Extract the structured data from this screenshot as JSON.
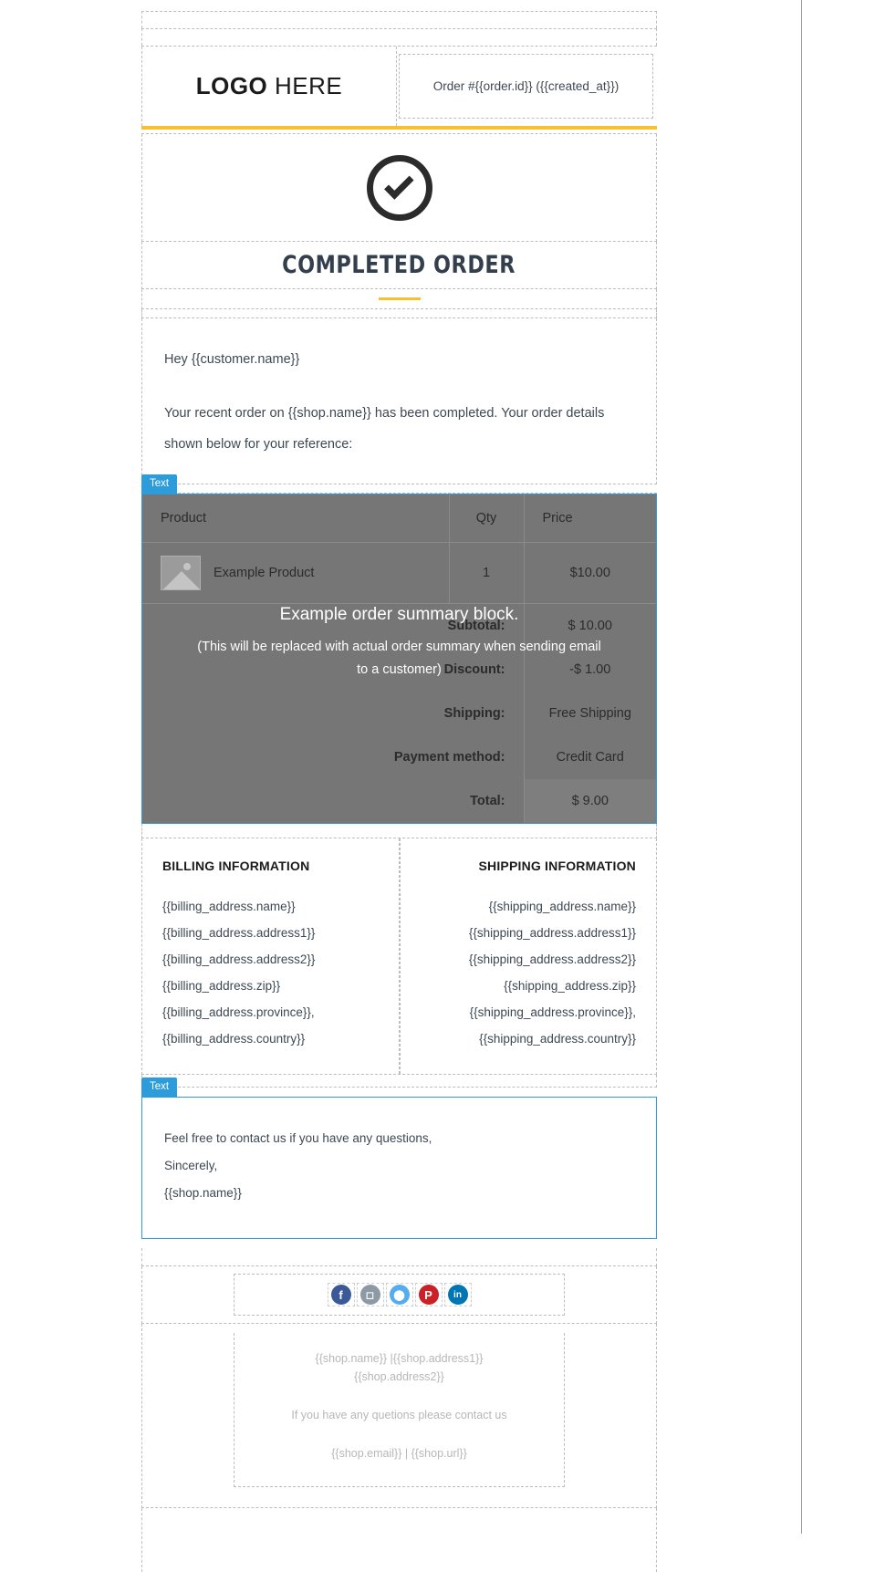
{
  "editor": {
    "selected_block_badge": "Text",
    "accent_color": "#f5c130",
    "selection_color": "#2d9cdb"
  },
  "header": {
    "logo_bold": "LOGO",
    "logo_light": "HERE",
    "order_id_line": "Order #{{order.id}} ({{created_at}})"
  },
  "hero": {
    "icon": "check-circle-icon",
    "title": "COMPLETED ORDER"
  },
  "intro": {
    "greeting": "Hey  {{customer.name}}",
    "body": "Your recent order on {{shop.name}}  has been completed. Your order details shown below for your reference:"
  },
  "order_table": {
    "columns": [
      "Product",
      "Qty",
      "Price"
    ],
    "rows": [
      {
        "product": "Example Product",
        "qty": "1",
        "price": "$10.00",
        "image": "image-placeholder-icon"
      }
    ],
    "summary": [
      {
        "label": "Subtotal:",
        "value": "$ 10.00"
      },
      {
        "label": "Discount:",
        "value": "-$ 1.00"
      },
      {
        "label": "Shipping:",
        "value": "Free Shipping"
      },
      {
        "label": "Payment method:",
        "value": "Credit Card"
      },
      {
        "label": "Total:",
        "value": "$ 9.00"
      }
    ],
    "overlay_title": "Example order summary block.",
    "overlay_note": "(This will be replaced with actual order summary when sending email to a customer)"
  },
  "billing": {
    "title": "BILLING INFORMATION",
    "lines": [
      "{{billing_address.name}}",
      "{{billing_address.address1}}",
      "{{billing_address.address2}}",
      "{{billing_address.zip}}",
      "{{billing_address.province}},",
      "{{billing_address.country}}"
    ]
  },
  "shipping": {
    "title": "SHIPPING INFORMATION",
    "lines": [
      "{{shipping_address.name}}",
      "{{shipping_address.address1}}",
      "{{shipping_address.address2}}",
      "{{shipping_address.zip}}",
      "{{shipping_address.province}},",
      "{{shipping_address.country}}"
    ]
  },
  "contact": {
    "line1": "Feel free to contact us if you have any questions,",
    "line2": "Sincerely,",
    "line3": "{{shop.name}}"
  },
  "footer": {
    "social": [
      {
        "name": "facebook-icon",
        "glyph": "f",
        "color": "#3b5998"
      },
      {
        "name": "instagram-icon",
        "glyph": "▣",
        "color": "#8d9aa5"
      },
      {
        "name": "twitter-icon",
        "glyph": "ᵗ",
        "color": "#55acee"
      },
      {
        "name": "pinterest-icon",
        "glyph": "P",
        "color": "#cb2027"
      },
      {
        "name": "linkedin-icon",
        "glyph": "in",
        "color": "#0077b5"
      }
    ],
    "address_line1": "{{shop.name}} |{{shop.address1}}",
    "address_line2": "{{shop.address2}}",
    "contact_line": "If you have any quetions please contact us",
    "links_line": "{{shop.email}} | {{shop.url}}"
  }
}
